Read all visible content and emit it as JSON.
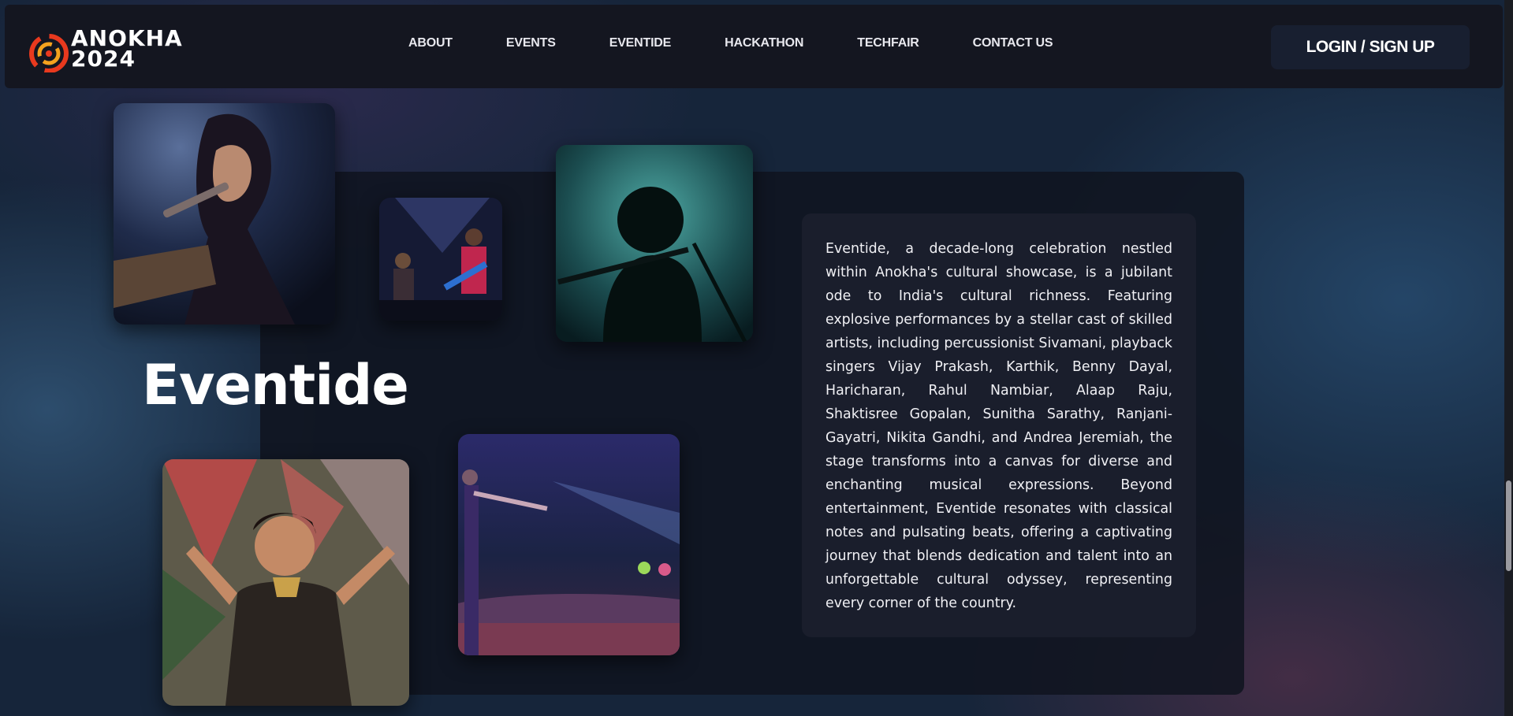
{
  "brand": {
    "logo_line1": "ANOKHA",
    "logo_line2": "2024",
    "accent_colors": [
      "#e8391e",
      "#f4a21e"
    ]
  },
  "nav": {
    "items": [
      "ABOUT",
      "EVENTS",
      "EVENTIDE",
      "HACKATHON",
      "TECHFAIR",
      "CONTACT US"
    ],
    "login_label": "LOGIN / SIGN UP"
  },
  "section": {
    "title": "Eventide",
    "description": "Eventide, a decade-long celebration nestled within Anokha's cultural showcase, is a jubilant ode to India's cultural richness. Featuring explosive performances by a stellar cast of skilled artists, including percussionist Sivamani, playback singers Vijay Prakash, Karthik, Benny Dayal, Haricharan, Rahul Nambiar, Alaap Raju, Shaktisree Gopalan, Sunitha Sarathy, Ranjani-Gayatri, Nikita Gandhi, and Andrea Jeremiah, the stage transforms into a canvas for diverse and enchanting musical expressions. Beyond entertainment, Eventide resonates with classical notes and pulsating beats, offering a captivating journey that blends dedication and talent into an unforgettable cultural odyssey, representing every corner of the country.",
    "photos": [
      {
        "name": "singer-with-microphone-photo"
      },
      {
        "name": "band-on-stage-photo"
      },
      {
        "name": "flute-player-silhouette-photo"
      },
      {
        "name": "classical-dancer-photo"
      },
      {
        "name": "crowd-concert-photo"
      }
    ]
  }
}
